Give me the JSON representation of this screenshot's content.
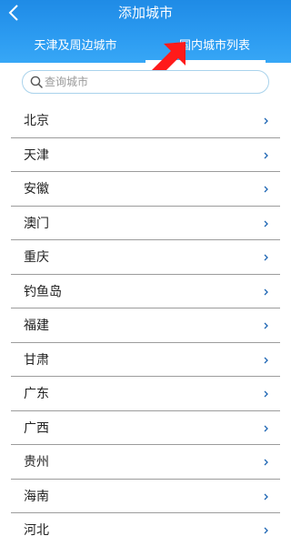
{
  "header": {
    "title": "添加城市",
    "back_icon": "chevron-left-icon"
  },
  "tabs": [
    {
      "label": "天津及周边城市",
      "active": false
    },
    {
      "label": "国内城市列表",
      "active": true
    }
  ],
  "annotation": {
    "icon": "red-pointer-arrow-icon",
    "color": "#ff1a1a"
  },
  "search": {
    "placeholder": "查询城市",
    "value": "",
    "icon": "search-icon"
  },
  "colors": {
    "header": "#2b9af0",
    "search_border": "#aad3ec",
    "divider": "#9c9c9c",
    "chevron": "#1e66b4"
  },
  "cities": [
    {
      "name": "北京"
    },
    {
      "name": "天津"
    },
    {
      "name": "安徽"
    },
    {
      "name": "澳门"
    },
    {
      "name": "重庆"
    },
    {
      "name": "钓鱼岛"
    },
    {
      "name": "福建"
    },
    {
      "name": "甘肃"
    },
    {
      "name": "广东"
    },
    {
      "name": "广西"
    },
    {
      "name": "贵州"
    },
    {
      "name": "海南"
    },
    {
      "name": "河北"
    }
  ]
}
